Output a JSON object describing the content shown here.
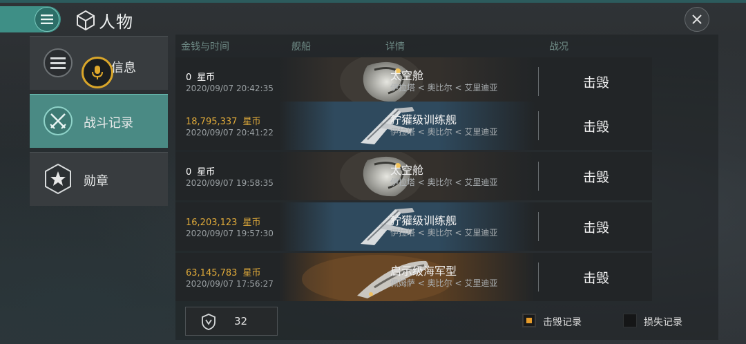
{
  "header": {
    "title": "人物"
  },
  "sidebar": {
    "items": [
      {
        "label": "信息"
      },
      {
        "label": "战斗记录"
      },
      {
        "label": "勋章"
      }
    ]
  },
  "table": {
    "columns": [
      "金钱与时间",
      "舰船",
      "详情",
      "战况"
    ],
    "rows": [
      {
        "money": "0",
        "unit": "星币",
        "time": "2020/09/07  20:42:35",
        "ship": "太空舱",
        "location": "伊拉塔 < 奥比尔 < 艾里迪亚",
        "status": "击毁",
        "money_color": "white",
        "ship_type": "capsule",
        "bg": "#34302c"
      },
      {
        "money": "18,795,337",
        "unit": "星币",
        "time": "2020/09/07  20:41:22",
        "ship": "狞獾级训练舰",
        "location": "伊拉塔 < 奥比尔 < 艾里迪亚",
        "status": "击毁",
        "money_color": "gold",
        "ship_type": "frigate",
        "bg": "#2f4a5e"
      },
      {
        "money": "0",
        "unit": "星币",
        "time": "2020/09/07  19:58:35",
        "ship": "太空舱",
        "location": "伊拉塔 < 奥比尔 < 艾里迪亚",
        "status": "击毁",
        "money_color": "white",
        "ship_type": "capsule",
        "bg": "#34302c"
      },
      {
        "money": "16,203,123",
        "unit": "星币",
        "time": "2020/09/07  19:57:30",
        "ship": "狞獾级训练舰",
        "location": "伊拉塔 < 奥比尔 < 艾里迪亚",
        "status": "击毁",
        "money_color": "gold",
        "ship_type": "frigate",
        "bg": "#2f4a5e"
      },
      {
        "money": "63,145,783",
        "unit": "星币",
        "time": "2020/09/07  17:56:27",
        "ship": "启示级海军型",
        "location": "佩姆萨 < 奥比尔 < 艾里迪亚",
        "status": "击毁",
        "money_color": "gold",
        "ship_type": "battleship",
        "bg": "#5a3e22"
      }
    ]
  },
  "footer": {
    "count": "32",
    "legend": [
      {
        "label": "击毁记录",
        "color": "#e69b2a"
      },
      {
        "label": "损失记录",
        "color": "#151617"
      }
    ]
  }
}
